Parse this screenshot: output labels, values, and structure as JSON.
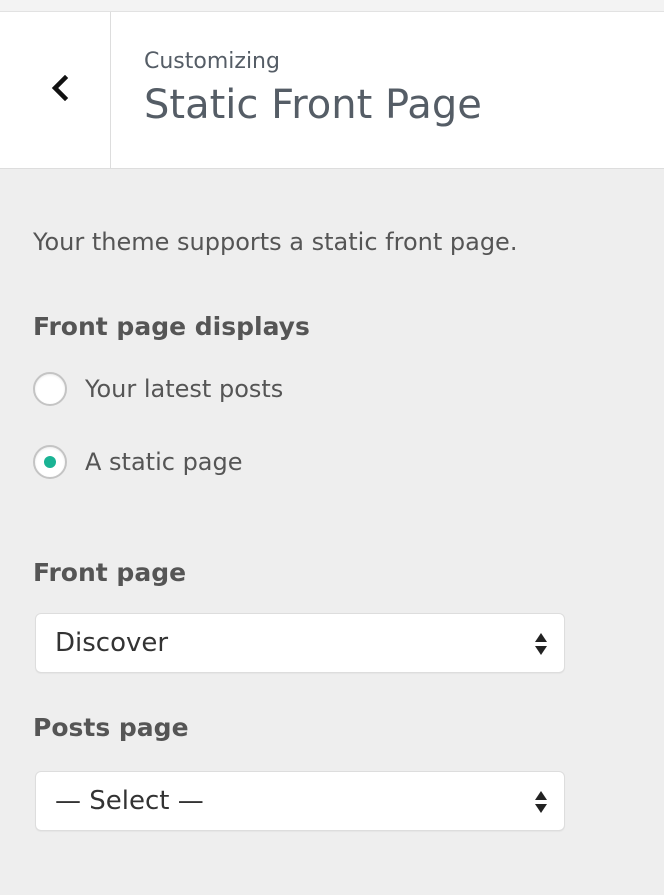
{
  "header": {
    "back_icon": "chevron-left-icon",
    "breadcrumb": "Customizing",
    "title": "Static Front Page"
  },
  "section": {
    "description": "Your theme supports a static front page.",
    "front_page_displays": {
      "label": "Front page displays",
      "options": [
        {
          "label": "Your latest posts",
          "checked": false
        },
        {
          "label": "A static page",
          "checked": true
        }
      ]
    },
    "front_page": {
      "label": "Front page",
      "selected": "Discover"
    },
    "posts_page": {
      "label": "Posts page",
      "selected": "— Select —"
    }
  },
  "colors": {
    "accent": "#1ab394",
    "background": "#eeeeee"
  }
}
